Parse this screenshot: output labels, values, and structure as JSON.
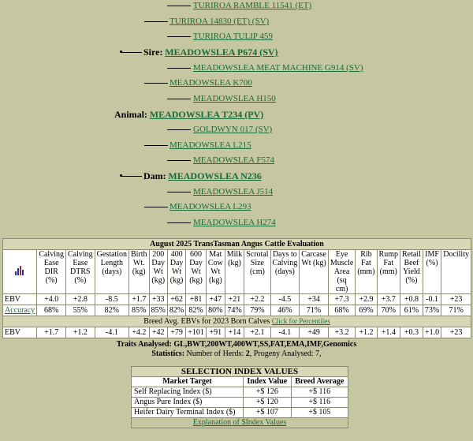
{
  "pedigree": {
    "sire_sire_sire": "TURIROA RAMBLE 11541 (ET)",
    "sire_sire": "TURIROA 14830 (ET) (SV)",
    "sire_sire_dam": "TURIROA TULIP 459",
    "sire_label": "Sire:",
    "sire": "MEADOWSLEA P674 (SV)",
    "sire_dam_sire": "MEADOWSLEA MEAT MACHINE G914 (SV)",
    "sire_dam": "MEADOWSLEA K700",
    "sire_dam_dam": "MEADOWSLEA H150",
    "animal_label": "Animal:",
    "animal": "MEADOWSLEA T234 (PV)",
    "dam_sire_sire": "GOLDWYN 017 (SV)",
    "dam_sire": "MEADOWSLEA L215",
    "dam_sire_dam": "MEADOWSLEA F574",
    "dam_label": "Dam:",
    "dam": "MEADOWSLEA N236",
    "dam_dam_sire": "MEADOWSLEA J514",
    "dam_dam": "MEADOWSLEA L293",
    "dam_dam_dam": "MEADOWSLEA H274"
  },
  "ebv_table": {
    "title": "August 2025 TransTasman Angus Cattle Evaluation",
    "headers": [
      "Calving Ease DIR (%)",
      "Calving Ease DTRS (%)",
      "Gestation Length (days)",
      "Birth Wt. (kg)",
      "200 Day Wt (kg)",
      "400 Day Wt (kg)",
      "600 Day Wt (kg)",
      "Mat Cow Wt (kg)",
      "Milk (kg)",
      "Scrotal Size (cm)",
      "Days to Calving (days)",
      "Carcase Wt (kg)",
      "Eye Muscle Area (sq cm)",
      "Rib Fat (mm)",
      "Rump Fat (mm)",
      "Retail Beef Yield (%)",
      "IMF (%)",
      "Docility"
    ],
    "ebv_label": "EBV",
    "ebv": [
      "+4.0",
      "+2.8",
      "-8.5",
      "+1.7",
      "+33",
      "+62",
      "+81",
      "+47",
      "+21",
      "+2.2",
      "-4.5",
      "+34",
      "+7.3",
      "+2.9",
      "+3.7",
      "+0.8",
      "-0.1",
      "+23"
    ],
    "accuracy_label": "Accuracy",
    "accuracy": [
      "68%",
      "55%",
      "82%",
      "85%",
      "85%",
      "82%",
      "82%",
      "80%",
      "74%",
      "79%",
      "46%",
      "71%",
      "68%",
      "69%",
      "70%",
      "61%",
      "73%",
      "71%"
    ],
    "breed_avg_text": "Breed Avg. EBVs for 2023 Born Calves",
    "percentiles_link": "Click for Percentiles",
    "breed_label": "EBV",
    "breed": [
      "+1.7",
      "+1.2",
      "-4.1",
      "+4.2",
      "+42",
      "+79",
      "+101",
      "+91",
      "+14",
      "+2.1",
      "-4.1",
      "+49",
      "+3.2",
      "+1.2",
      "+1.4",
      "+0.3",
      "+1.0",
      "+23"
    ]
  },
  "traits": "Traits Analysed: GL,BWT,200WT,400WT,SS,FAT,EMA,IMF,Genomics",
  "stats": {
    "label": "Statistics:",
    "text": "Number of Herds: ",
    "herds": "2",
    "sep": ", Progeny Analysed: ",
    "progeny": "7,"
  },
  "selection": {
    "title": "SELECTION INDEX VALUES",
    "headers": [
      "Market Target",
      "Index Value",
      "Breed Average"
    ],
    "rows": [
      {
        "name": "Self Replacing Index ($)",
        "value": "+$ 126",
        "avg": "+$ 116"
      },
      {
        "name": "Angus Pure Index ($)",
        "value": "+$ 120",
        "avg": "+$ 116"
      },
      {
        "name": "Heifer Dairy Terminal Index ($)",
        "value": "+$ 107",
        "avg": "+$ 105"
      }
    ],
    "explain_link": "Explanation of $Index Values"
  },
  "icon": "bar-chart-icon"
}
